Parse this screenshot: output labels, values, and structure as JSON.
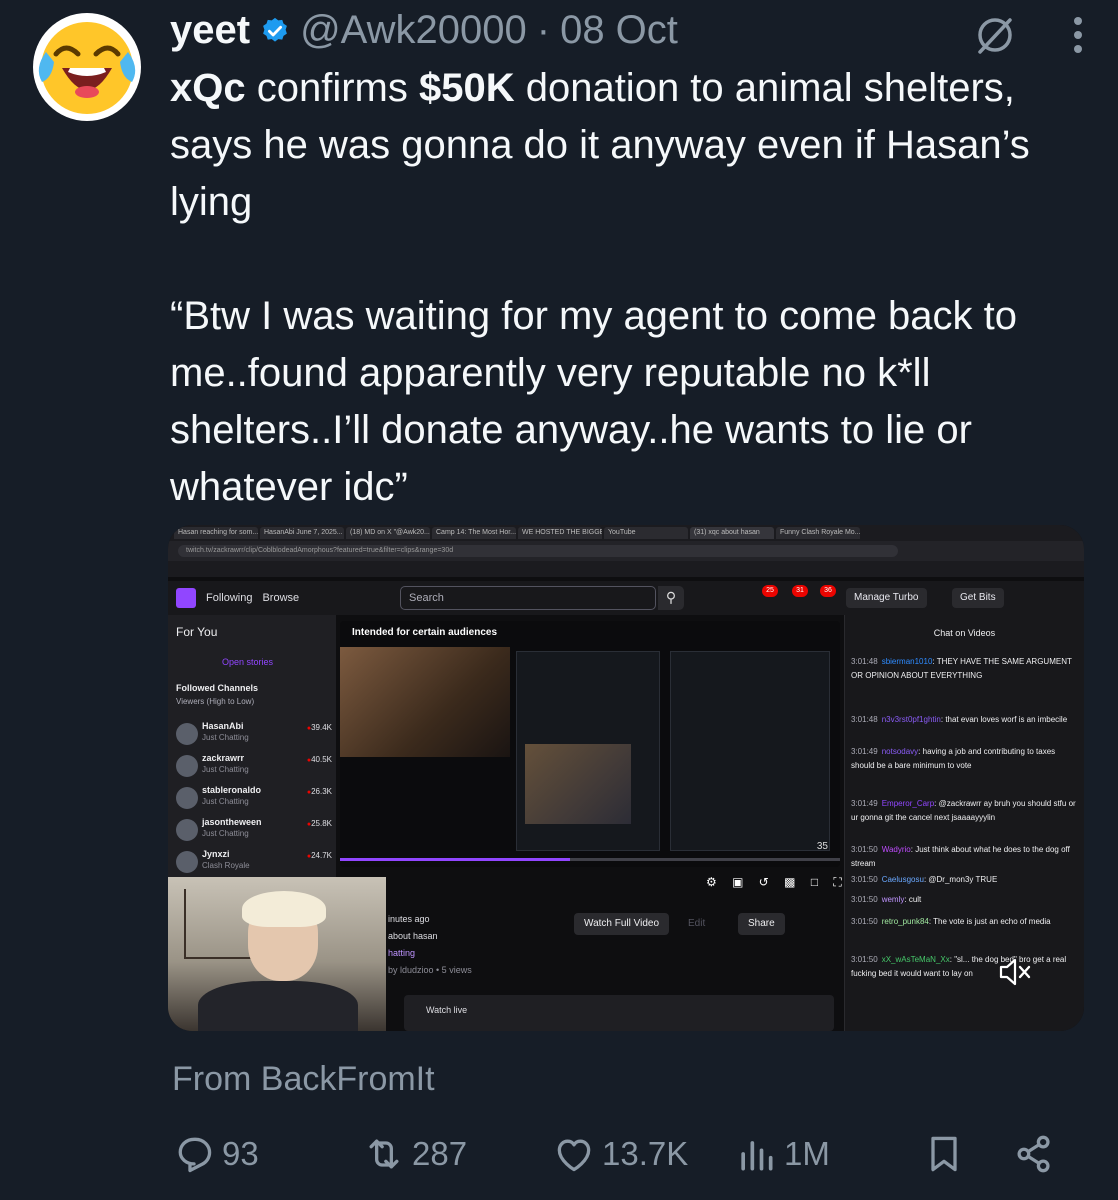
{
  "tweet": {
    "display_name": "yeet",
    "handle": "@Awk20000",
    "separator": "·",
    "date": "08 Oct",
    "text_part1_bold_prefix": "xQc",
    "text_part1_mid": " confirms ",
    "text_part1_bold_amount": "$50K",
    "text_part1_rest": " donation to animal shelters, says he was gonna do it anyway even if Hasan’s lying",
    "quote": "“Btw I was waiting for my agent to come back to me..found apparently very reputable no k*ll shelters..I’ll donate anyway..he wants to lie or whatever idc”",
    "source": "From BackFromIt"
  },
  "actions": {
    "replies": "93",
    "retweets": "287",
    "likes": "13.7K",
    "views": "1M"
  },
  "media": {
    "browser_tabs": [
      "Hasan reaching for som...",
      "HasanAbi June 7, 2025...",
      "(18) MD on X \"@Awk20...",
      "Camp 14: The Most Hor...",
      "WE HOSTED THE BIGGE...",
      "YouTube",
      "(31) xqc about hasan",
      "Funny Clash Royale Mo..."
    ],
    "url": "twitch.tv/zackrawrr/clip/CoblblodeadAmorphous?featured=true&filter=clips&range=30d",
    "twitch": {
      "nav_following": "Following",
      "nav_browse": "Browse",
      "search_placeholder": "Search",
      "badges": [
        "25",
        "31",
        "36"
      ],
      "manage_turbo": "Manage Turbo",
      "get_bits": "Get Bits",
      "for_you": "For You",
      "open_stories": "Open stories",
      "followed_channels": "Followed Channels",
      "sort": "Viewers (High to Low)",
      "channels": [
        {
          "name": "HasanAbi",
          "game": "Just Chatting",
          "viewers": "39.4K"
        },
        {
          "name": "zackrawrr",
          "game": "Just Chatting",
          "viewers": "40.5K"
        },
        {
          "name": "stableronaldo",
          "game": "Just Chatting",
          "viewers": "26.3K"
        },
        {
          "name": "jasontheween",
          "game": "Just Chatting",
          "viewers": "25.8K"
        },
        {
          "name": "Jynxzi",
          "game": "Clash Royale",
          "viewers": "24.7K"
        }
      ],
      "audience_label": "Intended for certain audiences",
      "video_number": "35",
      "info_lines": [
        "inutes ago",
        "about hasan",
        "hatting",
        "by ldudzioo • 5 views"
      ],
      "watch_full_video": "Watch Full Video",
      "edit": "Edit",
      "share": "Share",
      "watch_live": "Watch live",
      "chat_header": "Chat on Videos",
      "chat": [
        {
          "time": "3:01:48",
          "user": "sbierman1010",
          "color": "#2e8bff",
          "text": "THEY HAVE THE SAME ARGUMENT OR OPINION ABOUT EVERYTHING"
        },
        {
          "time": "3:01:48",
          "user": "n3v3rst0pf1ghtin",
          "color": "#8a5cf6",
          "text": "that evan loves worf is an imbecile"
        },
        {
          "time": "3:01:49",
          "user": "notsodavy",
          "color": "#8a5cf6",
          "text": "having a job and contributing to taxes should be a bare minimum to vote"
        },
        {
          "time": "3:01:49",
          "user": "Emperor_Carp",
          "color": "#9146ff",
          "text": "@zackrawrr ay bruh you should stfu or ur gonna git the cancel next jsaaaayyylin"
        },
        {
          "time": "3:01:50",
          "user": "Wadyrio",
          "color": "#c04cff",
          "text": "Just think about what he does to the dog off stream"
        },
        {
          "time": "3:01:50",
          "user": "Caelusgosu",
          "color": "#6aa8ff",
          "text": "@Dr_mon3y TRUE"
        },
        {
          "time": "3:01:50",
          "user": "wemly",
          "color": "#bf94ff",
          "text": "cult"
        },
        {
          "time": "3:01:50",
          "user": "retro_punk84",
          "color": "#a0e8a0",
          "text": "The vote is just an echo of media"
        },
        {
          "time": "3:01:50",
          "user": "xX_wAsTeMaN_Xx",
          "color": "#46c96a",
          "text": "\"sl... the dog bed\" bro get a real fucking bed it would want to lay on"
        }
      ]
    }
  },
  "colors": {
    "background": "#161d27",
    "verified": "#1d9bf0",
    "muted_text": "#8b98a5",
    "twitch_purple": "#9146ff"
  },
  "icons": [
    "verified-badge-icon",
    "grok-icon",
    "more-icon",
    "reply-icon",
    "retweet-icon",
    "like-icon",
    "views-icon",
    "bookmark-icon",
    "share-icon",
    "mute-icon"
  ]
}
